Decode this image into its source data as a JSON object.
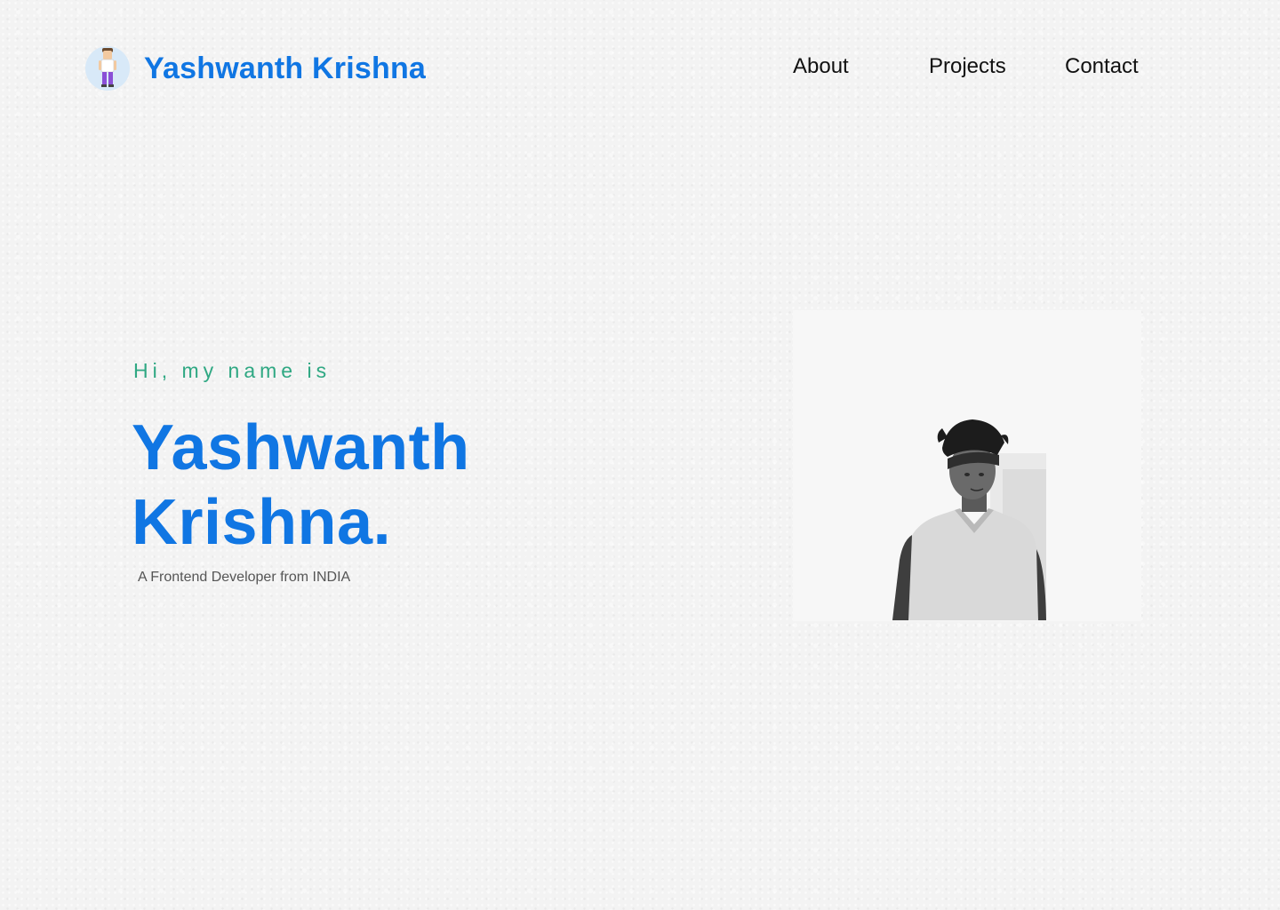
{
  "header": {
    "brand_name": "Yashwanth Krishna",
    "avatar_icon": "person-avatar-icon",
    "nav": [
      {
        "label": "About"
      },
      {
        "label": "Projects"
      },
      {
        "label": "Contact"
      }
    ]
  },
  "hero": {
    "greeting": "Hi, my name is",
    "name_line1": "Yashwanth",
    "name_line2": "Krishna.",
    "subtitle": "A Frontend Developer from INDIA",
    "photo": "profile-photo"
  },
  "colors": {
    "brand": "#1076e3",
    "greeting": "#2fa883",
    "text": "#111111",
    "muted": "#555555",
    "background": "#f3f3f3"
  }
}
